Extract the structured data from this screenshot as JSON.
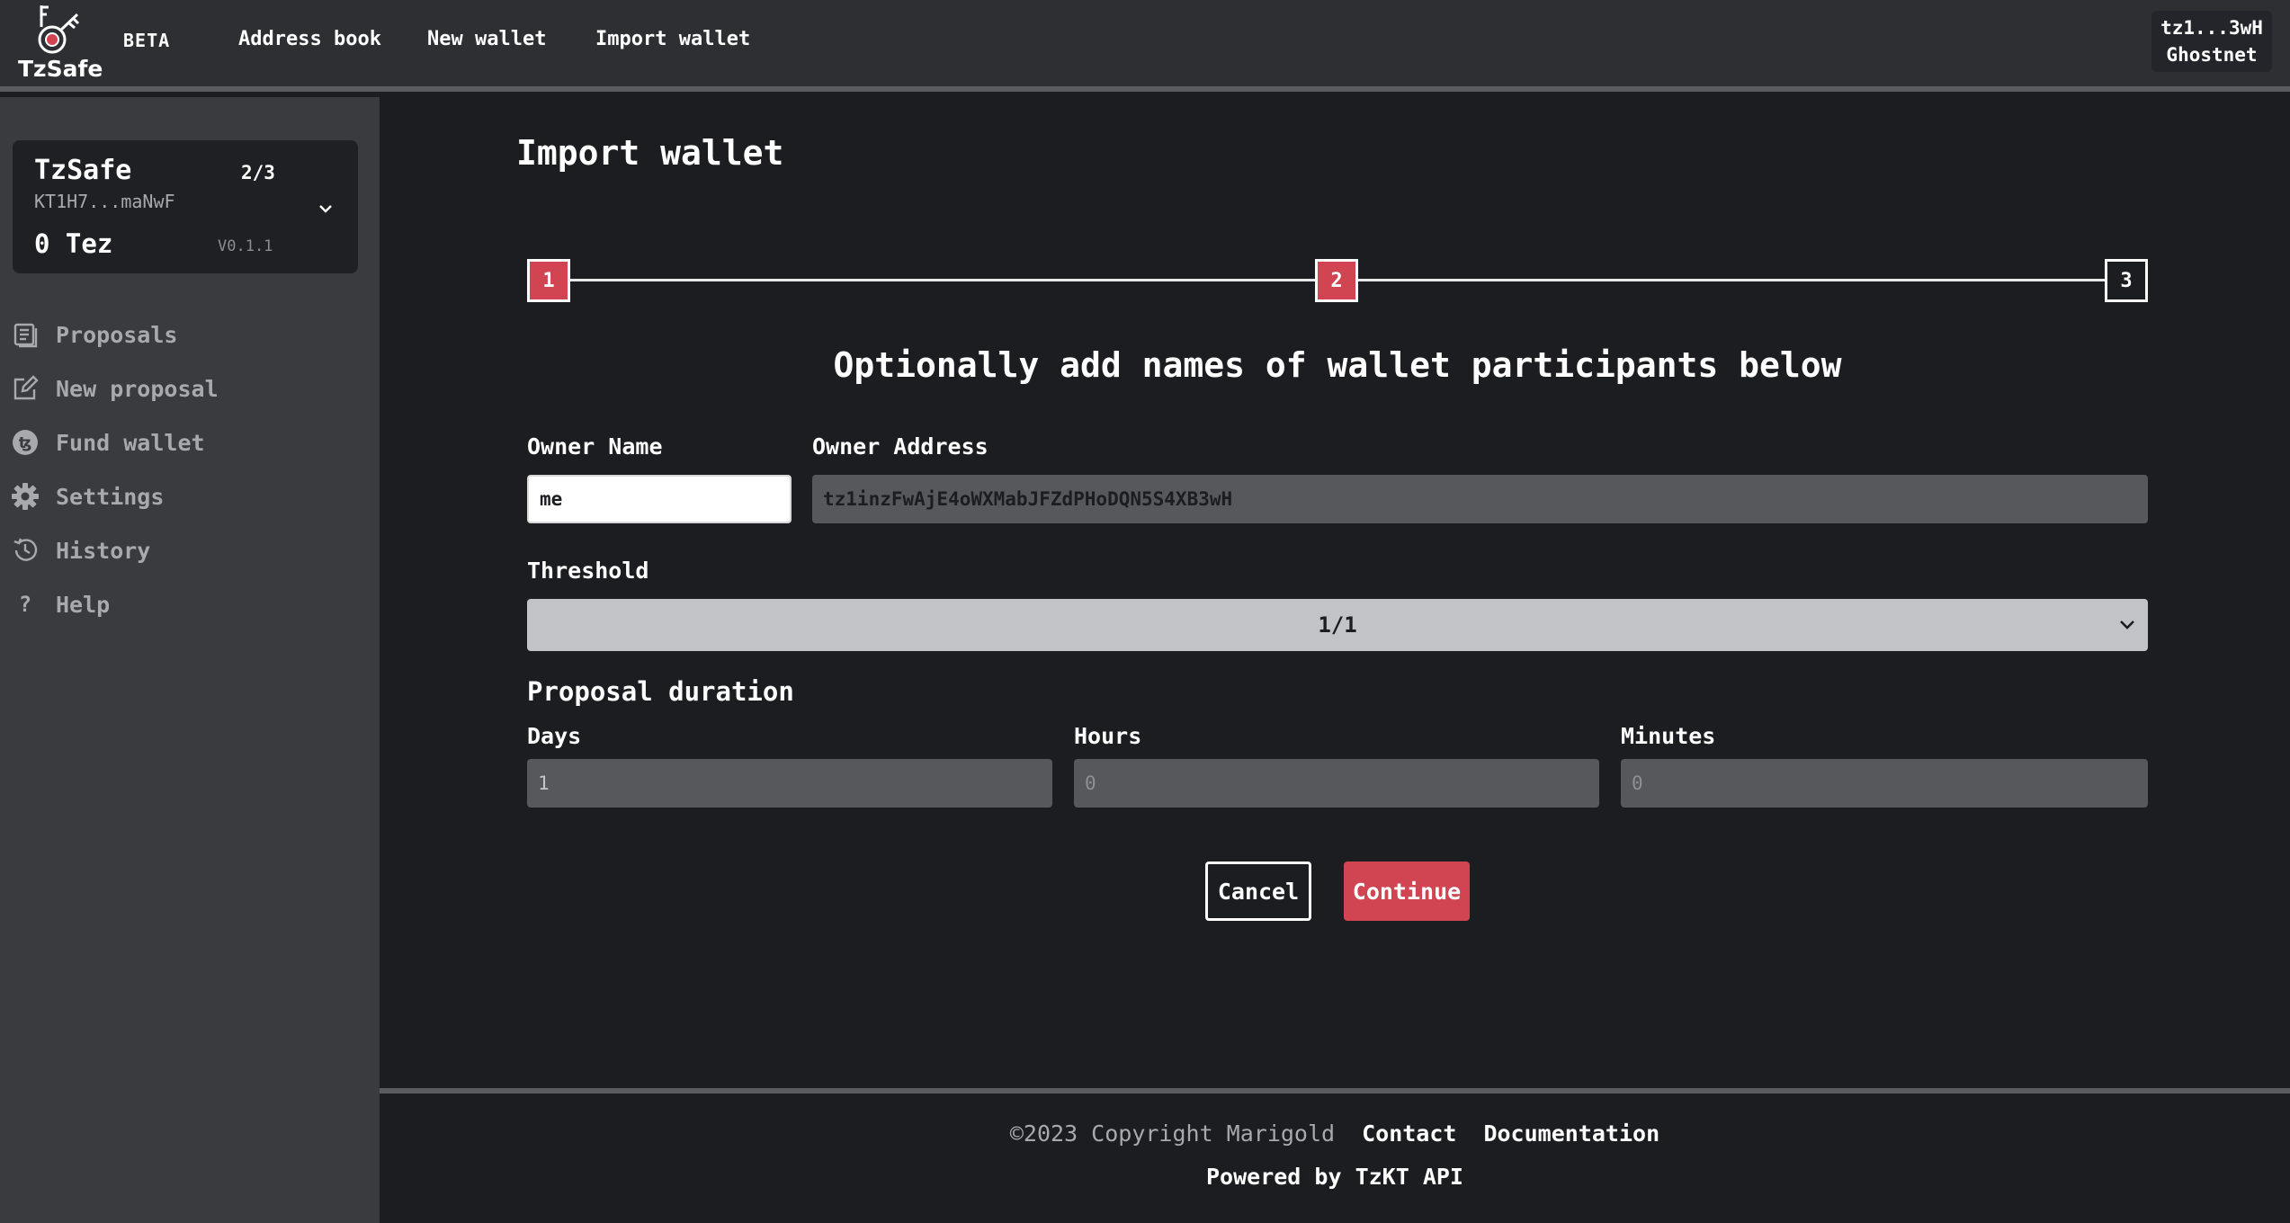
{
  "header": {
    "logo_text": "TzSafe",
    "beta": "BETA",
    "nav": [
      "Address book",
      "New wallet",
      "Import wallet"
    ],
    "account_address": "tz1...3wH",
    "network": "Ghostnet"
  },
  "sidebar": {
    "wallet": {
      "name": "TzSafe",
      "threshold": "2/3",
      "address": "KT1H7...maNwF",
      "balance": "0 Tez",
      "version": "V0.1.1"
    },
    "items": [
      {
        "label": "Proposals",
        "icon": "document-list-icon"
      },
      {
        "label": "New proposal",
        "icon": "edit-icon"
      },
      {
        "label": "Fund wallet",
        "icon": "tezos-coin-icon"
      },
      {
        "label": "Settings",
        "icon": "gear-icon"
      },
      {
        "label": "History",
        "icon": "history-icon"
      },
      {
        "label": "Help",
        "icon": "question-icon"
      }
    ]
  },
  "main": {
    "title": "Import wallet",
    "steps": [
      "1",
      "2",
      "3"
    ],
    "subtitle": "Optionally add names of wallet participants below",
    "owner_name_label": "Owner Name",
    "owner_name_value": "me",
    "owner_address_label": "Owner Address",
    "owner_address_value": "tz1inzFwAjE4oWXMabJFZdPHoDQN5S4XB3wH",
    "threshold_label": "Threshold",
    "threshold_value": "1/1",
    "duration_title": "Proposal duration",
    "days_label": "Days",
    "days_value": "1",
    "hours_label": "Hours",
    "hours_placeholder": "0",
    "minutes_label": "Minutes",
    "minutes_placeholder": "0",
    "cancel_label": "Cancel",
    "continue_label": "Continue"
  },
  "footer": {
    "copyright": "©2023 Copyright Marigold",
    "contact": "Contact",
    "documentation": "Documentation",
    "powered_by": "Powered by TzKT API"
  },
  "colors": {
    "accent": "#d14451",
    "background": "#1c1d21",
    "sidebar": "#3a3b3f",
    "topbar": "#2e2f33"
  }
}
